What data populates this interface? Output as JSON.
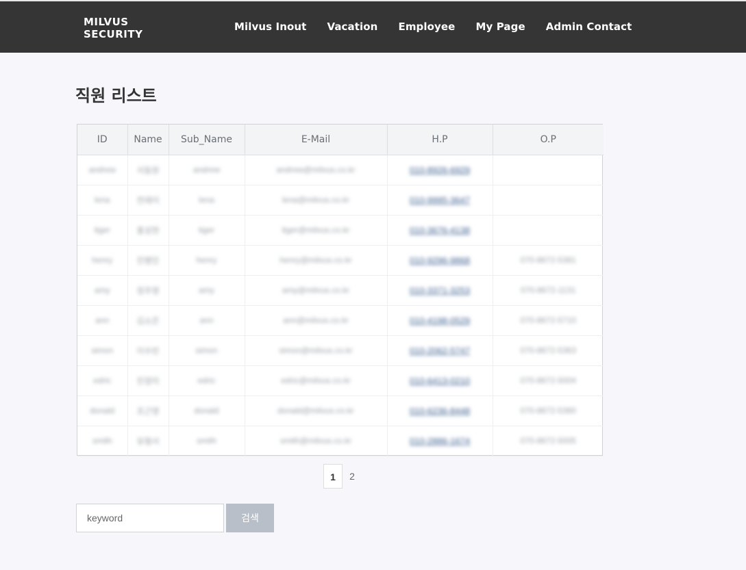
{
  "brand": {
    "line1": "MILVUS",
    "line2": "SECURITY"
  },
  "nav": [
    {
      "label": "Milvus Inout"
    },
    {
      "label": "Vacation"
    },
    {
      "label": "Employee"
    },
    {
      "label": "My Page"
    },
    {
      "label": "Admin Contact"
    }
  ],
  "page_title": "직원 리스트",
  "table": {
    "headers": [
      "ID",
      "Name",
      "Sub_Name",
      "E-Mail",
      "H.P",
      "O.P"
    ],
    "rows": [
      [
        "andrew",
        "서동원",
        "andrew",
        "andrew@milvus.co.kr",
        "010-8926-6929",
        ""
      ],
      [
        "lena",
        "전레이",
        "lena",
        "lena@milvus.co.kr",
        "010-9995-3647",
        ""
      ],
      [
        "tiger",
        "홍성현",
        "tiger",
        "tiger@milvus.co.kr",
        "010-3676-4138",
        ""
      ],
      [
        "henry",
        "진병민",
        "henry",
        "henry@milvus.co.kr",
        "010-9296-9868",
        "070-8672-5381"
      ],
      [
        "amy",
        "정주영",
        "amy",
        "amy@milvus.co.kr",
        "010-3371-3253",
        "070-8672-1131"
      ],
      [
        "ann",
        "김소은",
        "ann",
        "ann@milvus.co.kr",
        "010-4198-0529",
        "070-8672-5710"
      ],
      [
        "simon",
        "이수빈",
        "simon",
        "simon@milvus.co.kr",
        "010-2062-5747",
        "070-8672-5363"
      ],
      [
        "edric",
        "진정미",
        "edric",
        "edric@milvus.co.kr",
        "010-6413-0210",
        "070-8672-5004"
      ],
      [
        "donald",
        "조근영",
        "donald",
        "donald@milvus.co.kr",
        "010-6236-8448",
        "070-8672-5360"
      ],
      [
        "smith",
        "유형서",
        "smith",
        "smith@milvus.co.kr",
        "010-2886-1674",
        "070-8672-5005"
      ]
    ]
  },
  "pagination": {
    "pages": [
      "1",
      "2"
    ],
    "current": "1"
  },
  "search": {
    "placeholder": "keyword",
    "button_label": "검색"
  },
  "colors": {
    "topbar": "#353535",
    "button": "#b8bfc9",
    "link": "#3d5f8f"
  }
}
